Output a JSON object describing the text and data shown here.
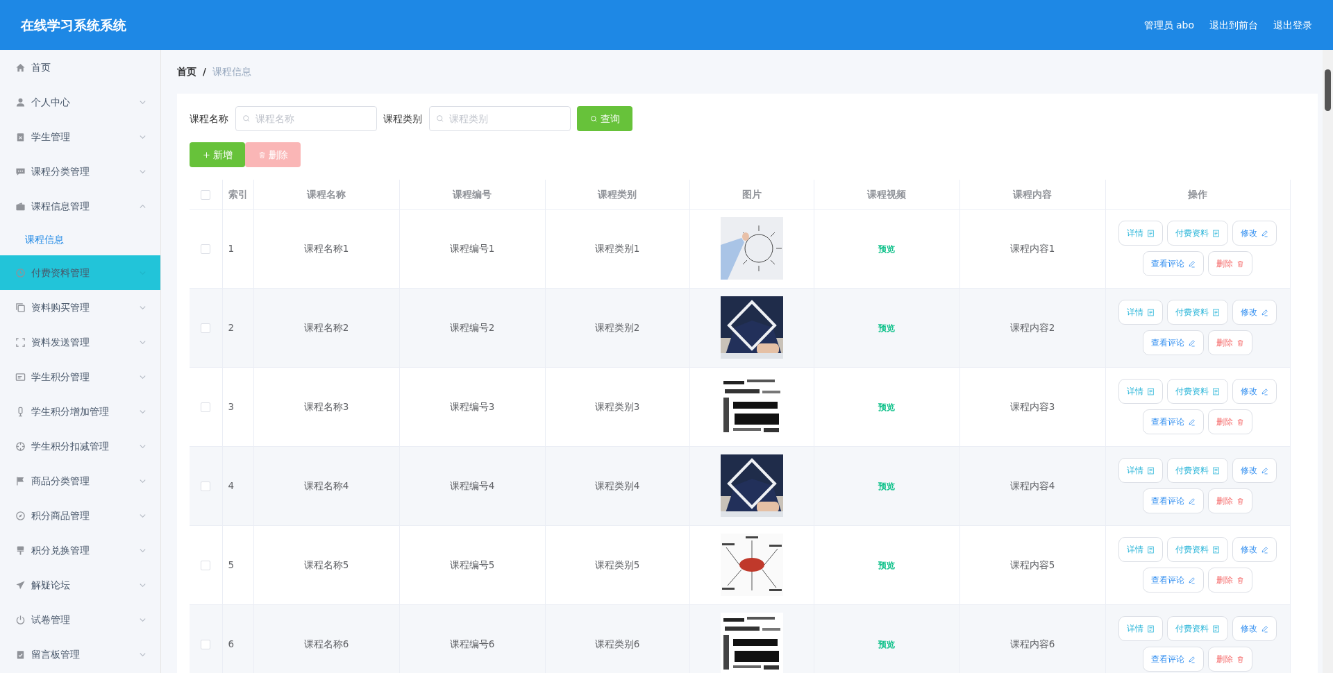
{
  "header": {
    "title": "在线学习系统系统",
    "links": [
      "管理员 abo",
      "退出到前台",
      "退出登录"
    ]
  },
  "sidebar": {
    "items": [
      {
        "label": "首页",
        "hovered": false
      },
      {
        "label": "个人中心",
        "hovered": false,
        "expanded": false
      },
      {
        "label": "学生管理",
        "hovered": false,
        "expanded": false
      },
      {
        "label": "课程分类管理",
        "hovered": false,
        "expanded": false
      },
      {
        "label": "课程信息管理",
        "hovered": false,
        "expanded": true,
        "children": [
          {
            "label": "课程信息",
            "selected": true
          }
        ]
      },
      {
        "label": "付费资料管理",
        "hovered": true,
        "expanded": false
      },
      {
        "label": "资料购买管理",
        "hovered": false,
        "expanded": false
      },
      {
        "label": "资料发送管理",
        "hovered": false,
        "expanded": false
      },
      {
        "label": "学生积分管理",
        "hovered": false,
        "expanded": false
      },
      {
        "label": "学生积分增加管理",
        "hovered": false,
        "expanded": false
      },
      {
        "label": "学生积分扣减管理",
        "hovered": false,
        "expanded": false
      },
      {
        "label": "商品分类管理",
        "hovered": false,
        "expanded": false
      },
      {
        "label": "积分商品管理",
        "hovered": false,
        "expanded": false
      },
      {
        "label": "积分兑换管理",
        "hovered": false,
        "expanded": false
      },
      {
        "label": "解疑论坛",
        "hovered": false,
        "expanded": false
      },
      {
        "label": "试卷管理",
        "hovered": false,
        "expanded": false
      },
      {
        "label": "留言板管理",
        "hovered": false,
        "expanded": false
      }
    ]
  },
  "breadcrumb": {
    "items": [
      "首页",
      "课程信息"
    ],
    "separator": "/"
  },
  "search": {
    "fields": [
      {
        "label": "课程名称",
        "placeholder": "课程名称"
      },
      {
        "label": "课程类别",
        "placeholder": "课程类别"
      }
    ],
    "button": "查询"
  },
  "toolbar": [
    {
      "label": "新增",
      "kind": "add",
      "disabled": false
    },
    {
      "label": "删除",
      "kind": "delete",
      "disabled": true
    }
  ],
  "table": {
    "all_checked": false,
    "columns": [
      "索引",
      "课程名称",
      "课程编号",
      "课程类别",
      "图片",
      "课程视频",
      "课程内容",
      "操作"
    ],
    "rows": [
      {
        "checked": false,
        "index": "1",
        "name": "课程名称1",
        "code": "课程编号1",
        "category": "课程类别1",
        "video": "预览",
        "content": "课程内容1",
        "actions": [
          {
            "label": "详情",
            "kind": "detail"
          },
          {
            "label": "付费资料",
            "kind": "detail"
          },
          {
            "label": "修改",
            "kind": "edit"
          },
          {
            "label": "查看评论",
            "kind": "edit"
          },
          {
            "label": "删除",
            "kind": "delete"
          }
        ]
      },
      {
        "checked": false,
        "index": "2",
        "name": "课程名称2",
        "code": "课程编号2",
        "category": "课程类别2",
        "video": "预览",
        "content": "课程内容2",
        "actions": [
          {
            "label": "详情",
            "kind": "detail"
          },
          {
            "label": "付费资料",
            "kind": "detail"
          },
          {
            "label": "修改",
            "kind": "edit"
          },
          {
            "label": "查看评论",
            "kind": "edit"
          },
          {
            "label": "删除",
            "kind": "delete"
          }
        ]
      },
      {
        "checked": false,
        "index": "3",
        "name": "课程名称3",
        "code": "课程编号3",
        "category": "课程类别3",
        "video": "预览",
        "content": "课程内容3",
        "actions": [
          {
            "label": "详情",
            "kind": "detail"
          },
          {
            "label": "付费资料",
            "kind": "detail"
          },
          {
            "label": "修改",
            "kind": "edit"
          },
          {
            "label": "查看评论",
            "kind": "edit"
          },
          {
            "label": "删除",
            "kind": "delete"
          }
        ]
      },
      {
        "checked": false,
        "index": "4",
        "name": "课程名称4",
        "code": "课程编号4",
        "category": "课程类别4",
        "video": "预览",
        "content": "课程内容4",
        "actions": [
          {
            "label": "详情",
            "kind": "detail"
          },
          {
            "label": "付费资料",
            "kind": "detail"
          },
          {
            "label": "修改",
            "kind": "edit"
          },
          {
            "label": "查看评论",
            "kind": "edit"
          },
          {
            "label": "删除",
            "kind": "delete"
          }
        ]
      },
      {
        "checked": false,
        "index": "5",
        "name": "课程名称5",
        "code": "课程编号5",
        "category": "课程类别5",
        "video": "预览",
        "content": "课程内容5",
        "actions": [
          {
            "label": "详情",
            "kind": "detail"
          },
          {
            "label": "付费资料",
            "kind": "detail"
          },
          {
            "label": "修改",
            "kind": "edit"
          },
          {
            "label": "查看评论",
            "kind": "edit"
          },
          {
            "label": "删除",
            "kind": "delete"
          }
        ]
      },
      {
        "checked": false,
        "index": "6",
        "name": "课程名称6",
        "code": "课程编号6",
        "category": "课程类别6",
        "video": "预览",
        "content": "课程内容6",
        "actions": [
          {
            "label": "详情",
            "kind": "detail"
          },
          {
            "label": "付费资料",
            "kind": "detail"
          },
          {
            "label": "修改",
            "kind": "edit"
          },
          {
            "label": "查看评论",
            "kind": "edit"
          },
          {
            "label": "删除",
            "kind": "delete"
          }
        ]
      }
    ]
  }
}
